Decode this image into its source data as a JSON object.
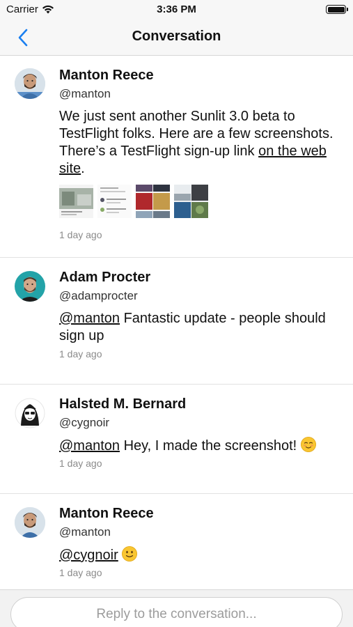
{
  "status_bar": {
    "carrier": "Carrier",
    "time": "3:36 PM"
  },
  "nav": {
    "title": "Conversation",
    "back_icon": "chevron-left-icon",
    "accent_color": "#1a7ff0"
  },
  "posts": [
    {
      "name": "Manton Reece",
      "handle": "@manton",
      "text_before": "We just sent another Sunlit 3.0 beta to TestFlight folks. Here are a few screenshots. There’s a TestFlight sign-up link ",
      "link": "on the web site",
      "text_after": ".",
      "date": "1 day ago",
      "thumbnails": 4
    },
    {
      "name": "Adam Procter",
      "handle": "@adamprocter",
      "mention": "@manton",
      "text": " Fantastic update - people should sign up",
      "date": "1 day ago"
    },
    {
      "name": "Halsted M. Bernard",
      "handle": "@cygnoir",
      "mention": "@manton",
      "text": " Hey, I made the screenshot! ",
      "emoji": "smiling-face-icon",
      "date": "1 day ago"
    },
    {
      "name": "Manton Reece",
      "handle": "@manton",
      "mention": "@cygnoir",
      "text": " ",
      "emoji": "slight-smile-icon",
      "date": "1 day ago"
    }
  ],
  "reply": {
    "placeholder": "Reply to the conversation..."
  }
}
